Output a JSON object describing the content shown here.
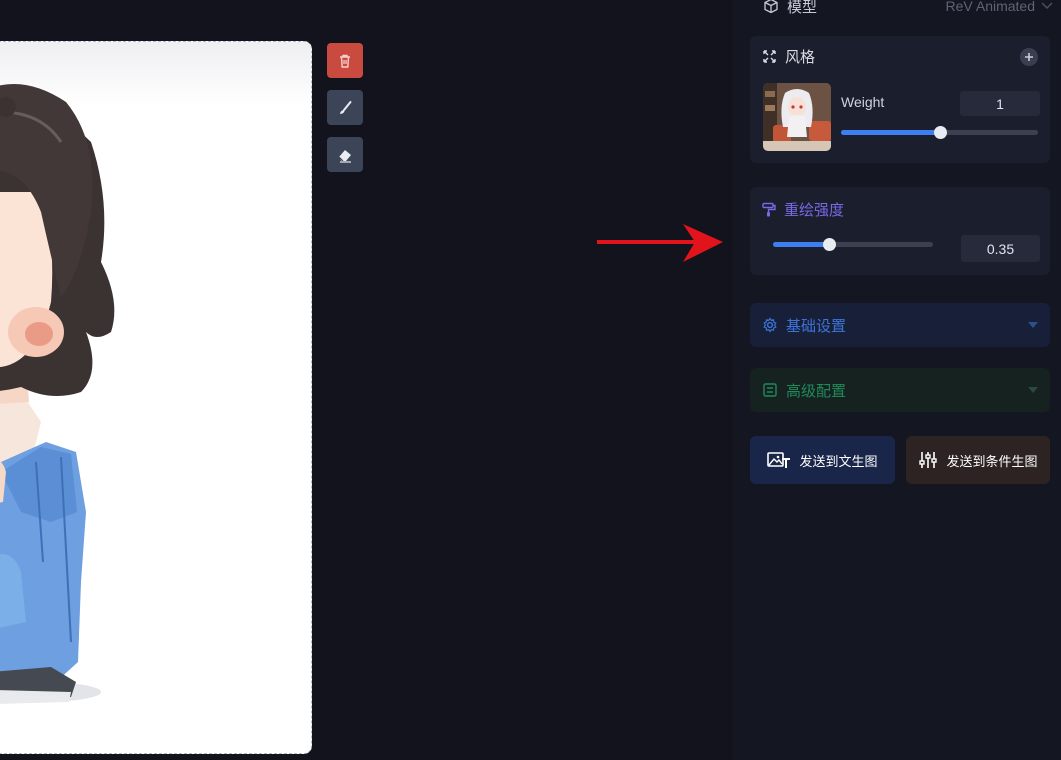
{
  "toolbar": {
    "delete_icon": "trash-icon",
    "brush_icon": "brush-icon",
    "eraser_icon": "eraser-icon"
  },
  "panel": {
    "model": {
      "label": "模型",
      "value": "ReV Animated"
    },
    "style": {
      "title": "风格",
      "weight_label": "Weight",
      "weight_value": "1",
      "weight_fraction": 0.5
    },
    "denoise": {
      "title": "重绘强度",
      "value": "0.35",
      "fraction": 0.35
    },
    "basic_settings": {
      "label": "基础设置"
    },
    "advanced_config": {
      "label": "高级配置"
    },
    "send_txt2img": {
      "label": "发送到文生图"
    },
    "send_conditional": {
      "label": "发送到条件生图"
    }
  },
  "colors": {
    "accent_blue": "#3d7ff0",
    "denoise_purple": "#7a68e6",
    "advanced_green": "#1f8a5c",
    "delete_red": "#c94a3f",
    "arrow_red": "#e0141a"
  }
}
